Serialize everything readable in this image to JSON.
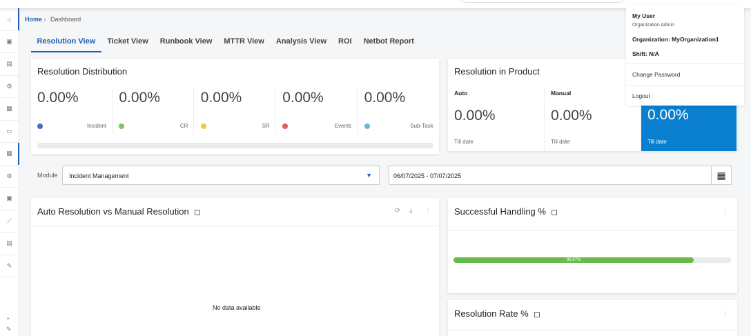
{
  "breadcrumb": {
    "home": "Home",
    "current": "Dashboard"
  },
  "tabs": [
    "Resolution View",
    "Ticket View",
    "Runbook View",
    "MTTR View",
    "Analysis View",
    "ROI",
    "Netbot Report"
  ],
  "resolution_distribution": {
    "title": "Resolution Distribution",
    "items": [
      {
        "value": "0.00%",
        "label": "Incident",
        "color": "#4a6cc0"
      },
      {
        "value": "0.00%",
        "label": "CR",
        "color": "#7cc25e"
      },
      {
        "value": "0.00%",
        "label": "SR",
        "color": "#f4c543"
      },
      {
        "value": "0.00%",
        "label": "Events",
        "color": "#e25b5b"
      },
      {
        "value": "0.00%",
        "label": "Sub-Task",
        "color": "#6bb6d6"
      }
    ]
  },
  "resolution_in_product": {
    "title": "Resolution in Product",
    "items": [
      {
        "label": "Auto",
        "value": "0.00%",
        "sub": "Till date"
      },
      {
        "label": "Manual",
        "value": "0.00%",
        "sub": "Till date"
      },
      {
        "label": "",
        "value": "0.00%",
        "sub": "Till date"
      }
    ]
  },
  "filters": {
    "module_label": "Module",
    "module_value": "Incident Management",
    "date_range": "06/07/2025 - 07/07/2025"
  },
  "auto_vs_manual": {
    "title": "Auto Resolution vs Manual Resolution",
    "empty": "No data available"
  },
  "successful_handling": {
    "title": "Successful Handling %",
    "value": 86.67,
    "value_label": "86.67%"
  },
  "resolution_rate": {
    "title": "Resolution Rate %"
  },
  "user_menu": {
    "name": "My User",
    "role": "Organization Admin",
    "organization": "Organization: MyOrganization1",
    "shift": "Shift: N/A",
    "change_password": "Change Password",
    "logout": "Logout"
  },
  "colors": {
    "accent": "#1b5fb5",
    "highlight": "#0a7fcf",
    "progress": "#67bb48"
  }
}
